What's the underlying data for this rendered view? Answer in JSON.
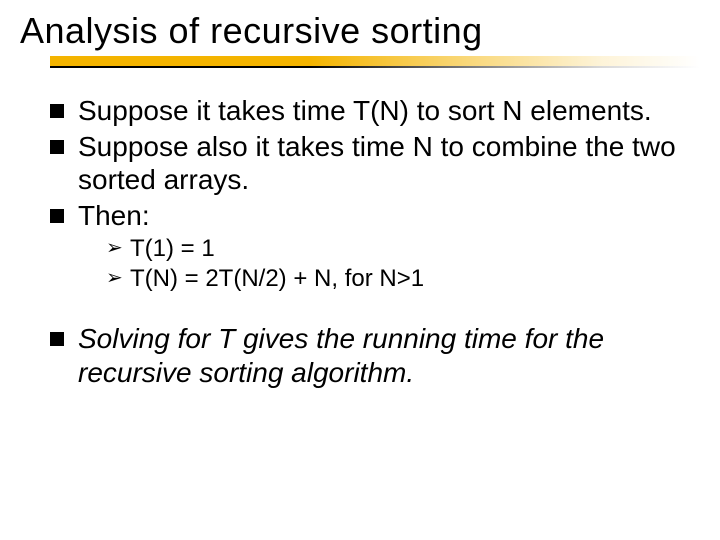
{
  "title": "Analysis of recursive sorting",
  "bullets": {
    "b1": "Suppose it takes time T(N) to sort N elements.",
    "b2": "Suppose also it takes time N to combine the two sorted arrays.",
    "b3": "Then:",
    "b4": "Solving for T gives the running time for the recursive sorting algorithm."
  },
  "sub": {
    "s1": "T(1) = 1",
    "s2": "T(N) = 2T(N/2) + N, for N>1"
  }
}
